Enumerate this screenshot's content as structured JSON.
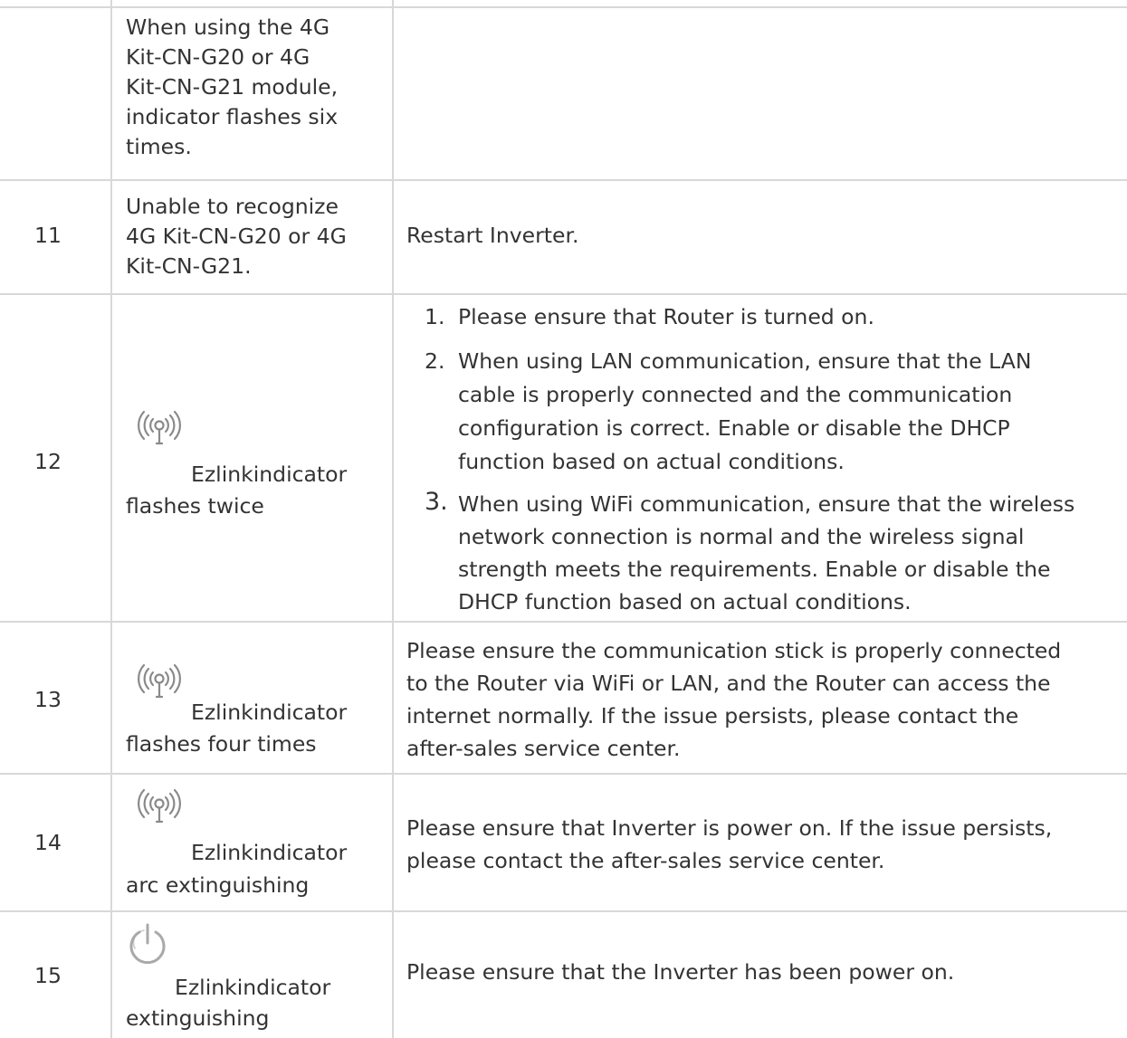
{
  "rows": [
    {
      "id": "10-cont",
      "description": [
        "When using the 4G",
        "Kit-CN-G20 or 4G",
        "Kit-CN-G21 module,",
        "indicator flashes six",
        "times."
      ]
    },
    {
      "id": "11",
      "number": "11",
      "description": [
        "Unable to recognize",
        "4G Kit-CN-G20 or 4G",
        "Kit-CN-G21."
      ],
      "solution": [
        "Restart Inverter."
      ]
    },
    {
      "id": "12",
      "number": "12",
      "icon": "ezlink-antenna-icon",
      "description": [
        "Ezlinkindicator",
        "flashes twice"
      ],
      "solution_list": [
        {
          "marker": "1.",
          "lines": [
            "Please ensure that Router is turned on."
          ]
        },
        {
          "marker": "2.",
          "lines": [
            "When using LAN communication, ensure that the LAN",
            "cable is properly connected and the communication",
            "configuration is correct. Enable or disable the DHCP",
            "function based on actual conditions."
          ]
        },
        {
          "marker": "3.",
          "lines": [
            "When using WiFi communication, ensure that the wireless",
            "network connection is normal and the wireless signal",
            "strength meets the requirements. Enable or disable the",
            "DHCP function based on actual conditions."
          ]
        }
      ]
    },
    {
      "id": "13",
      "number": "13",
      "icon": "ezlink-antenna-icon",
      "description": [
        "Ezlinkindicator",
        "flashes four times"
      ],
      "solution": [
        "Please ensure the communication stick is properly connected",
        "to the Router via WiFi or LAN, and the Router can access the",
        "internet normally. If the issue persists, please contact the",
        "after-sales service center."
      ]
    },
    {
      "id": "14",
      "number": "14",
      "icon": "ezlink-antenna-icon",
      "description": [
        "Ezlinkindicator",
        "arc extinguishing"
      ],
      "solution": [
        "Please ensure that Inverter is power on. If the issue persists,",
        "please contact the after-sales service center."
      ]
    },
    {
      "id": "15",
      "number": "15",
      "icon": "power-icon",
      "description": [
        "Ezlinkindicator",
        "extinguishing"
      ],
      "solution": [
        "Please ensure that the Inverter has been power on."
      ]
    }
  ]
}
